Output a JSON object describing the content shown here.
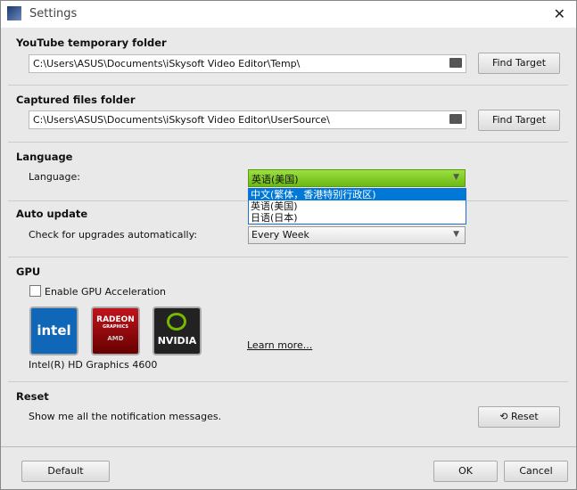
{
  "title": "Settings",
  "youtube": {
    "heading": "YouTube temporary folder",
    "path": "C:\\Users\\ASUS\\Documents\\iSkysoft Video Editor\\Temp\\",
    "button": "Find Target"
  },
  "captured": {
    "heading": "Captured files folder",
    "path": "C:\\Users\\ASUS\\Documents\\iSkysoft Video Editor\\UserSource\\",
    "button": "Find Target"
  },
  "language": {
    "heading": "Language",
    "label": "Language:",
    "selected": "英语(美国)",
    "options": [
      "中文(繁体，香港特别行政区)",
      "英语(美国)",
      "日语(日本)"
    ]
  },
  "autoupdate": {
    "heading": "Auto update",
    "label": "Check for upgrades automatically:",
    "selected": "Every Week"
  },
  "gpu": {
    "heading": "GPU",
    "checkbox": "Enable GPU Acceleration",
    "checked": false,
    "logos": [
      "intel",
      "RADEON",
      "GRAPHICS",
      "AMD",
      "NVIDIA"
    ],
    "learn_more": "Learn more...",
    "device": "Intel(R) HD Graphics 4600"
  },
  "reset": {
    "heading": "Reset",
    "label": "Show me all the notification messages.",
    "button": "Reset"
  },
  "footer": {
    "default": "Default",
    "ok": "OK",
    "cancel": "Cancel"
  },
  "colors": {
    "accent": "#0078d7",
    "lang_select": "#7ec81c"
  }
}
